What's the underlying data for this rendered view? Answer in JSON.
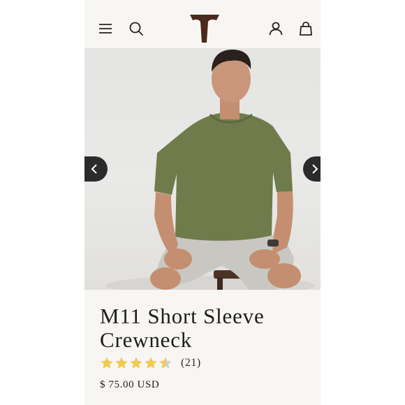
{
  "header": {
    "menu_icon": "hamburger-menu-icon",
    "search_icon": "search-icon",
    "logo": "T",
    "account_icon": "account-icon",
    "cart_icon": "shopping-bag-icon"
  },
  "gallery": {
    "prev_icon": "chevron-left-icon",
    "next_icon": "chevron-right-icon",
    "image": "model-in-olive-short-sleeve-crewneck"
  },
  "product": {
    "title": "M11 Short Sleeve Crewneck",
    "rating": 4.5,
    "rating_max": 5,
    "review_count": "(21)",
    "price": "$ 75.00 USD"
  },
  "colors": {
    "background": "#f8f6f2",
    "logo": "#4a2a1a",
    "star": "#f2c94c",
    "star_empty": "#cfcfcf",
    "shirt": "#6f7b4a",
    "arrow_bg": "#2b2b2b"
  }
}
